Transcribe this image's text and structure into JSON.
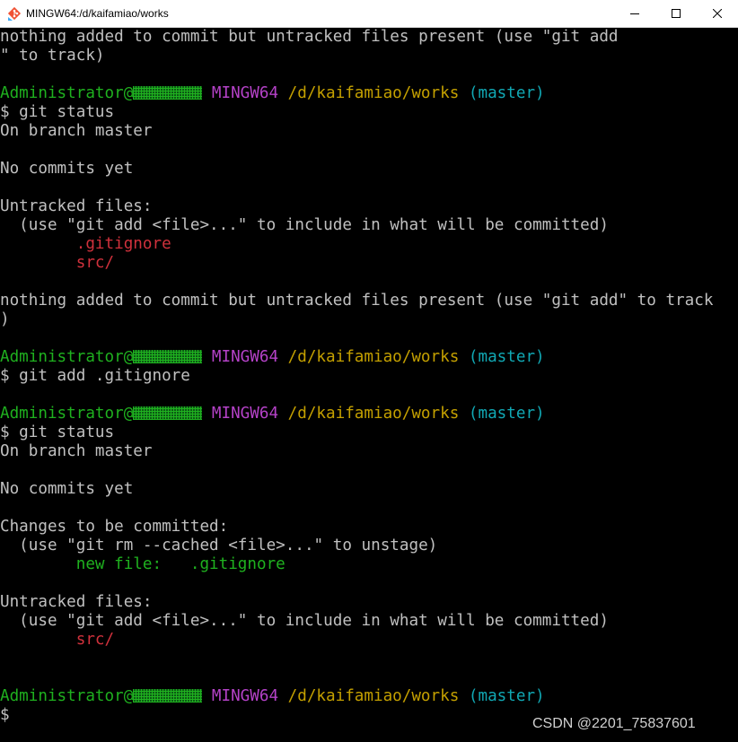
{
  "window": {
    "title": "MINGW64:/d/kaifamiao/works",
    "icon": "git-bash-icon",
    "controls": [
      "minimize-icon",
      "maximize-icon",
      "close-icon"
    ]
  },
  "colors": {
    "background": "#000000",
    "text": "#c0c0c0",
    "user": "#1fb11f",
    "env": "#b542c8",
    "path": "#c4a000",
    "branch": "#11a8b4",
    "untracked": "#d0313c",
    "staged": "#1fb11f"
  },
  "prompt": {
    "user": "Administrator@",
    "env": "MINGW64",
    "path": "/d/kaifamiao/works",
    "branch": "(master)"
  },
  "terminal": {
    "l01": "nothing added to commit but untracked files present (use \"git add",
    "l02": "\" to track)",
    "l04_cmd": "$ git status",
    "l05": "On branch master",
    "l07": "No commits yet",
    "l09": "Untracked files:",
    "l10": "  (use \"git add <file>...\" to include in what will be committed)",
    "l11": "        .gitignore",
    "l12": "        src/",
    "l14": "nothing added to commit but untracked files present (use \"git add\" to track",
    "l15": ")",
    "l17_cmd": "$ git add .gitignore",
    "l20_cmd": "$ git status",
    "l21": "On branch master",
    "l23": "No commits yet",
    "l25": "Changes to be committed:",
    "l26": "  (use \"git rm --cached <file>...\" to unstage)",
    "l27": "        new file:   .gitignore",
    "l29": "Untracked files:",
    "l30": "  (use \"git add <file>...\" to include in what will be committed)",
    "l31": "        src/",
    "l35_cmd": "$"
  },
  "watermark": "CSDN @2201_75837601"
}
